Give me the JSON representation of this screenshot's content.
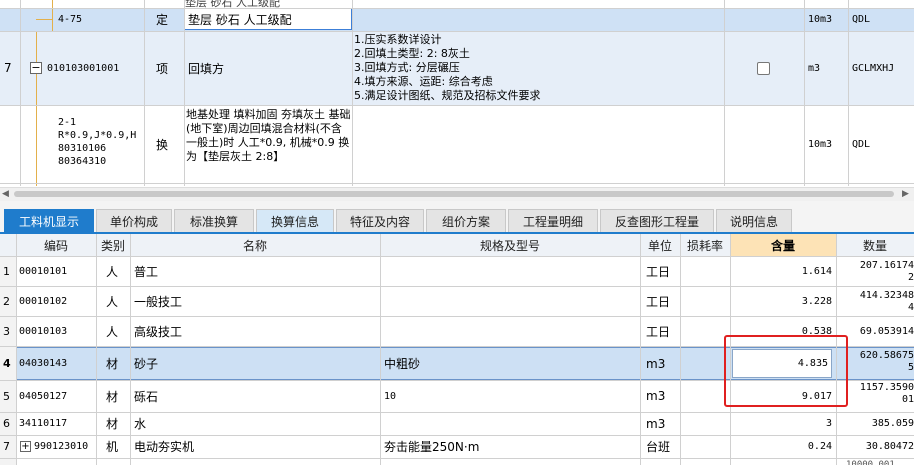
{
  "top_grid": {
    "rows": [
      {
        "no": "",
        "code": "4-75",
        "type": "定",
        "name": "垫层 砂石 人工级配",
        "feature": "",
        "unit": "10m3",
        "expr": "QDL"
      },
      {
        "no": "7",
        "code": "010103001001",
        "type": "项",
        "name": "回填方",
        "feature": [
          "1.压实系数详设计",
          "2.回填土类型: 2: 8灰土",
          "3.回填方式: 分层碾压",
          "4.填方来源、运距: 综合考虑",
          "5.满足设计图纸、规范及招标文件要求"
        ],
        "unit": "m3",
        "expr": "GCLMXHJ"
      },
      {
        "no": "",
        "code": [
          "2-1",
          "R*0.9,J*0.9,H",
          "80310106",
          "80364310"
        ],
        "type": "换",
        "name": "地基处理 填料加固 夯填灰土 基础(地下室)周边回填混合材料(不含一般土)时 人工*0.9, 机械*0.9 换为【垫层灰土 2:8】",
        "feature": "",
        "unit": "10m3",
        "expr": "QDL"
      }
    ],
    "expand_symbol": "−"
  },
  "tabs": [
    {
      "label": "工料机显示"
    },
    {
      "label": "单价构成"
    },
    {
      "label": "标准换算"
    },
    {
      "label": "换算信息"
    },
    {
      "label": "特征及内容"
    },
    {
      "label": "组价方案"
    },
    {
      "label": "工程量明细"
    },
    {
      "label": "反查图形工程量"
    },
    {
      "label": "说明信息"
    }
  ],
  "bottom_grid": {
    "headers": {
      "code": "编码",
      "type": "类别",
      "name": "名称",
      "spec": "规格及型号",
      "unit": "单位",
      "loss": "损耗率",
      "content": "含量",
      "qty": "数量"
    },
    "rows": [
      {
        "no": "1",
        "code": "00010101",
        "type": "人",
        "name": "普工",
        "spec": "",
        "unit": "工日",
        "content": "1.614",
        "qty": "207.16174\n2"
      },
      {
        "no": "2",
        "code": "00010102",
        "type": "人",
        "name": "一般技工",
        "spec": "",
        "unit": "工日",
        "content": "3.228",
        "qty": "414.32348\n4"
      },
      {
        "no": "3",
        "code": "00010103",
        "type": "人",
        "name": "高级技工",
        "spec": "",
        "unit": "工日",
        "content": "0.538",
        "qty": "69.053914"
      },
      {
        "no": "4",
        "code": "04030143",
        "type": "材",
        "name": "砂子",
        "spec": "中粗砂",
        "unit": "m3",
        "content": "4.835",
        "qty": "620.58675\n5"
      },
      {
        "no": "5",
        "code": "04050127",
        "type": "材",
        "name": "砾石",
        "spec": "10",
        "unit": "m3",
        "content": "9.017",
        "qty": "1157.3590\n01"
      },
      {
        "no": "6",
        "code": "34110117",
        "type": "材",
        "name": "水",
        "spec": "",
        "unit": "m3",
        "content": "3",
        "qty": "385.059"
      },
      {
        "no": "7",
        "code": "990123010",
        "type": "机",
        "name": "电动夯实机",
        "spec": "夯击能量250N·m",
        "unit": "台班",
        "content": "0.24",
        "qty": "30.80472"
      }
    ],
    "expand_symbol": "+",
    "partial_qty": "10000.001"
  }
}
